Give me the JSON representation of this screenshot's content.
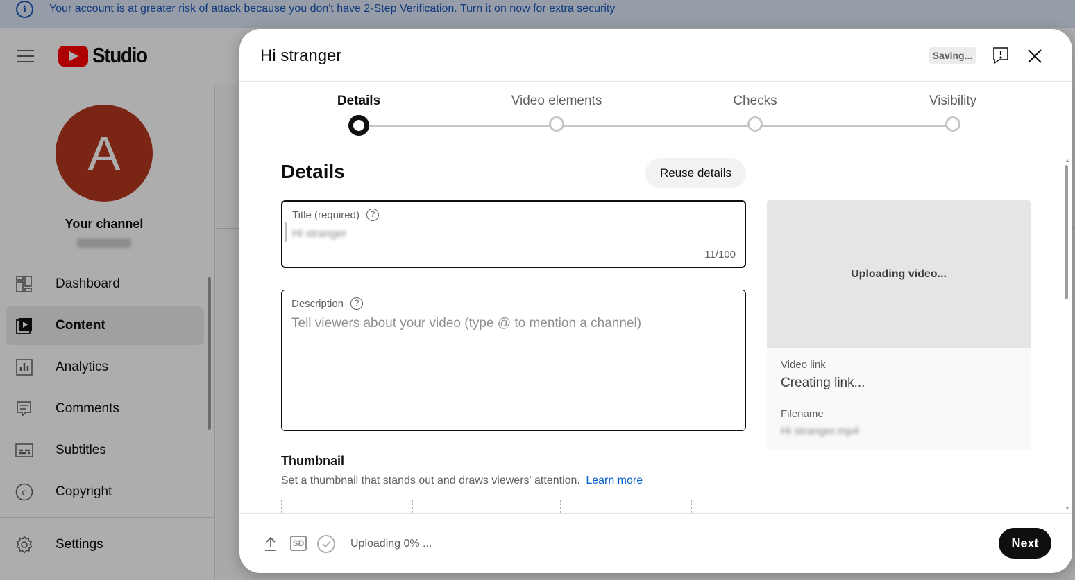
{
  "banner": {
    "icon": "info-icon",
    "text": "Your account is at greater risk of attack because you don't have 2-Step Verification. Turn it on now for extra security"
  },
  "header": {
    "logo": "Studio"
  },
  "sidebar": {
    "avatar_letter": "A",
    "channel_label": "Your channel",
    "items": [
      {
        "label": "Dashboard",
        "icon": "dashboard-icon",
        "active": false
      },
      {
        "label": "Content",
        "icon": "content-icon",
        "active": true
      },
      {
        "label": "Analytics",
        "icon": "analytics-icon",
        "active": false
      },
      {
        "label": "Comments",
        "icon": "comments-icon",
        "active": false
      },
      {
        "label": "Subtitles",
        "icon": "subtitles-icon",
        "active": false
      },
      {
        "label": "Copyright",
        "icon": "copyright-icon",
        "active": false
      },
      {
        "label": "Settings",
        "icon": "gear-icon",
        "active": false
      }
    ]
  },
  "dialog": {
    "title": "Hi stranger",
    "saving": "Saving...",
    "steps": [
      {
        "label": "Details",
        "active": true
      },
      {
        "label": "Video elements",
        "active": false
      },
      {
        "label": "Checks",
        "active": false
      },
      {
        "label": "Visibility",
        "active": false
      }
    ],
    "details": {
      "heading": "Details",
      "reuse_button": "Reuse details",
      "title_field": {
        "label": "Title (required)",
        "value": "Hi stranger",
        "count": "11/100"
      },
      "description_field": {
        "label": "Description",
        "placeholder": "Tell viewers about your video (type @ to mention a channel)"
      },
      "thumbnail": {
        "heading": "Thumbnail",
        "description": "Set a thumbnail that stands out and draws viewers' attention.",
        "learn_more": "Learn more"
      }
    },
    "preview": {
      "status": "Uploading video...",
      "video_link_label": "Video link",
      "video_link_value": "Creating link...",
      "filename_label": "Filename",
      "filename_value": "Hi stranger.mp4"
    },
    "footer": {
      "upload_status": "Uploading 0% ...",
      "sd_badge": "SD",
      "next_button": "Next"
    }
  },
  "colors": {
    "banner_bg": "#dde8f8",
    "banner_text": "#1a56b8",
    "logo_red": "#ff0000",
    "avatar": "#b5391f",
    "link": "#065fd4",
    "primary_button": "#0f0f0f"
  }
}
